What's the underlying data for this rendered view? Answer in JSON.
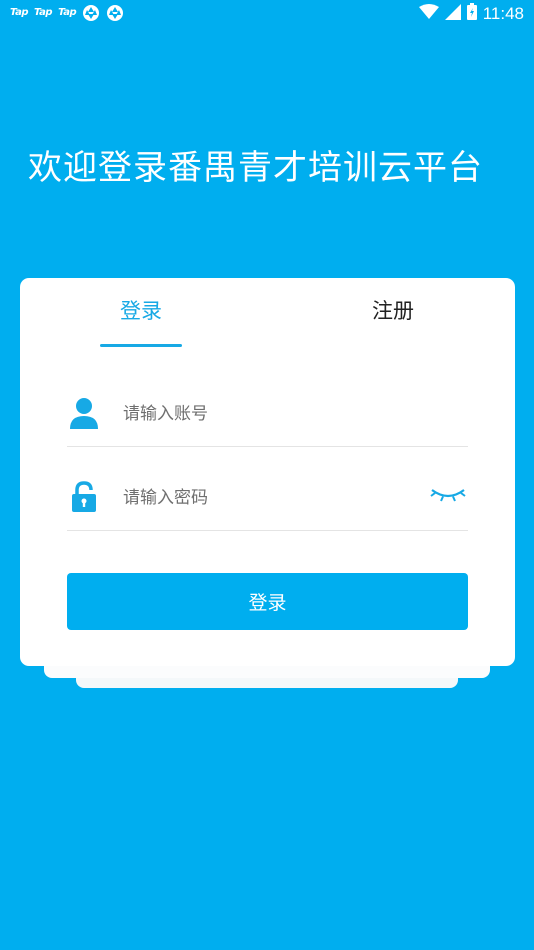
{
  "status_bar": {
    "app_icons": [
      "Tap",
      "Tap",
      "Tap"
    ],
    "notification_icons": [
      "aperture-icon",
      "aperture-icon"
    ],
    "system_icons": [
      "wifi-icon",
      "cell-signal-icon",
      "battery-icon"
    ],
    "time": "11:48"
  },
  "welcome": {
    "title": "欢迎登录番禺青才培训云平台"
  },
  "tabs": [
    {
      "label": "登录",
      "active": true
    },
    {
      "label": "注册",
      "active": false
    }
  ],
  "form": {
    "account": {
      "placeholder": "请输入账号",
      "value": "",
      "icon": "user-icon"
    },
    "password": {
      "placeholder": "请输入密码",
      "value": "",
      "icon": "lock-icon",
      "toggle_icon": "eye-closed-icon"
    },
    "submit_label": "登录"
  },
  "colors": {
    "background": "#00aeef",
    "accent": "#17a9e5",
    "card": "#ffffff",
    "button": "#00aeef"
  }
}
